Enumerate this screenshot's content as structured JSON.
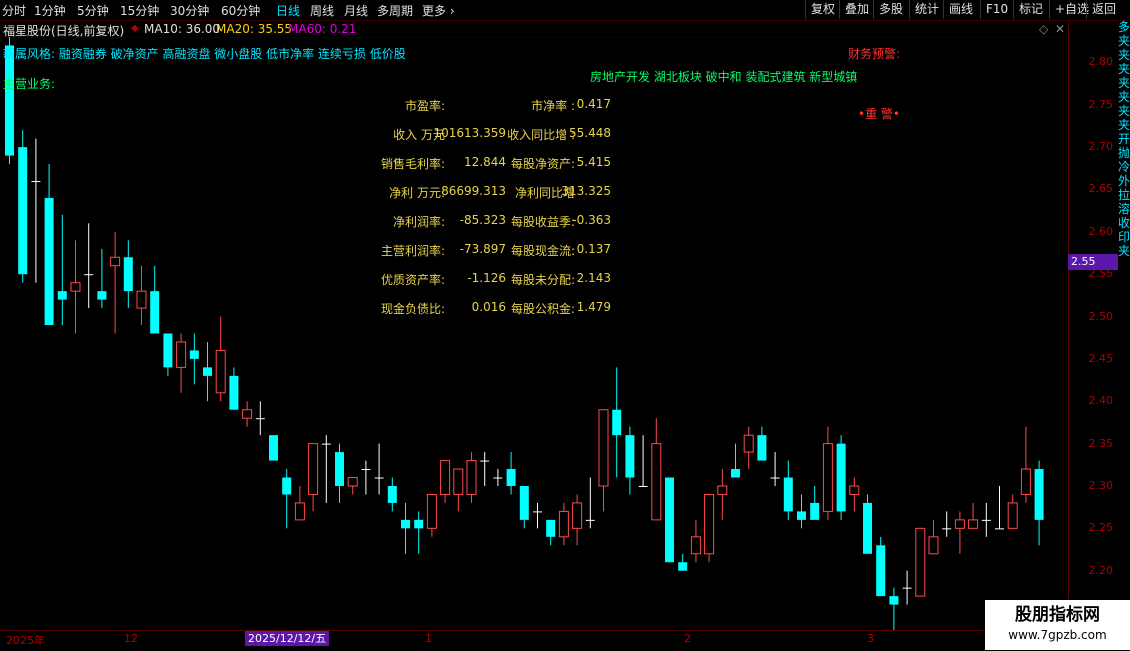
{
  "toolbar": {
    "timeframes": [
      "分时",
      "1分钟",
      "5分钟",
      "15分钟",
      "30分钟",
      "60分钟",
      "日线",
      "周线",
      "月线",
      "多周期",
      "更多"
    ],
    "active": "日线",
    "right_buttons": [
      "复权",
      "叠加",
      "多股",
      "统计",
      "画线",
      "F10",
      "标记",
      "+自选",
      "返回"
    ]
  },
  "title": {
    "stock": "福星股份(日线,前复权)",
    "ma10": "MA10: 36.00",
    "ma20": "MA20: 35.55",
    "ma60": "MA60: 0.21",
    "ma10_color": "#e0e0e0",
    "ma20_color": "#ffd200",
    "ma60_color": "#e000e0"
  },
  "tags": {
    "line1": "新属风格: 融资融券 破净资产 高融资盘 微小盘股 低市净率 连续亏损 低价股",
    "line2": "主营业务:",
    "concepts": "房地产开发 湖北板块 破中和 装配式建筑 新型城镇",
    "warning": "财务预警:",
    "heavy": "•重 警•"
  },
  "fundamentals": [
    {
      "l1": "市盈率:",
      "v1": "",
      "l2": "市净率 :",
      "v2": "0.417"
    },
    {
      "l1": "收入 万元",
      "v1": "101613.359",
      "l2": "收入同比增 :",
      "v2": "55.448"
    },
    {
      "l1": "销售毛利率:",
      "v1": "12.844",
      "l2": "每股净资产:",
      "v2": "5.415"
    },
    {
      "l1": "净利 万元:",
      "v1": "86699.313",
      "l2": "净利同比增",
      "v2": "313.325"
    },
    {
      "l1": "净利润率:",
      "v1": "-85.323",
      "l2": "每股收益季:",
      "v2": "-0.363"
    },
    {
      "l1": "主营利润率:",
      "v1": "-73.897",
      "l2": "每股现金流:",
      "v2": "0.137"
    },
    {
      "l1": "优质资产率:",
      "v1": "-1.126",
      "l2": "每股未分配:",
      "v2": "2.143"
    },
    {
      "l1": "现金负债比:",
      "v1": "0.016",
      "l2": "每股公积金:",
      "v2": "1.479"
    }
  ],
  "price_axis": {
    "ticks": [
      "2.80",
      "2.75",
      "2.70",
      "2.65",
      "2.60",
      "2.55",
      "2.50",
      "2.45",
      "2.40",
      "2.35",
      "2.30",
      "2.25",
      "2.20",
      "2.15"
    ],
    "current": "2.55"
  },
  "x_axis": {
    "labels": [
      "2025年",
      "12",
      "1",
      "2",
      "3"
    ],
    "selected": "2025/12/12/五"
  },
  "side_strip": "多夹夹夹夹夹夹夹开抛冷外拉溶收印夹",
  "watermark": {
    "name": "股朋指标网",
    "url": "www.7gpzb.com"
  },
  "chart_data": {
    "type": "candlestick",
    "up_color": "#ff4a4a",
    "down_color": "#00ffff",
    "ylim": [
      2.13,
      2.83
    ],
    "candles": [
      {
        "o": 2.82,
        "h": 2.85,
        "l": 2.68,
        "c": 2.69
      },
      {
        "o": 2.7,
        "h": 2.72,
        "l": 2.54,
        "c": 2.55
      },
      {
        "o": 2.66,
        "h": 2.71,
        "l": 2.54,
        "c": 2.66
      },
      {
        "o": 2.64,
        "h": 2.68,
        "l": 2.49,
        "c": 2.49
      },
      {
        "o": 2.53,
        "h": 2.62,
        "l": 2.49,
        "c": 2.52
      },
      {
        "o": 2.53,
        "h": 2.59,
        "l": 2.48,
        "c": 2.54
      },
      {
        "o": 2.55,
        "h": 2.61,
        "l": 2.51,
        "c": 2.55
      },
      {
        "o": 2.53,
        "h": 2.58,
        "l": 2.51,
        "c": 2.52
      },
      {
        "o": 2.56,
        "h": 2.6,
        "l": 2.48,
        "c": 2.57
      },
      {
        "o": 2.57,
        "h": 2.59,
        "l": 2.51,
        "c": 2.53
      },
      {
        "o": 2.51,
        "h": 2.56,
        "l": 2.49,
        "c": 2.53
      },
      {
        "o": 2.53,
        "h": 2.56,
        "l": 2.48,
        "c": 2.48
      },
      {
        "o": 2.48,
        "h": 2.48,
        "l": 2.43,
        "c": 2.44
      },
      {
        "o": 2.44,
        "h": 2.48,
        "l": 2.41,
        "c": 2.47
      },
      {
        "o": 2.46,
        "h": 2.48,
        "l": 2.42,
        "c": 2.45
      },
      {
        "o": 2.44,
        "h": 2.47,
        "l": 2.4,
        "c": 2.43
      },
      {
        "o": 2.41,
        "h": 2.5,
        "l": 2.4,
        "c": 2.46
      },
      {
        "o": 2.43,
        "h": 2.44,
        "l": 2.39,
        "c": 2.39
      },
      {
        "o": 2.38,
        "h": 2.4,
        "l": 2.37,
        "c": 2.39
      },
      {
        "o": 2.38,
        "h": 2.4,
        "l": 2.36,
        "c": 2.38
      },
      {
        "o": 2.36,
        "h": 2.36,
        "l": 2.33,
        "c": 2.33
      },
      {
        "o": 2.31,
        "h": 2.32,
        "l": 2.25,
        "c": 2.29
      },
      {
        "o": 2.26,
        "h": 2.3,
        "l": 2.26,
        "c": 2.28
      },
      {
        "o": 2.29,
        "h": 2.35,
        "l": 2.27,
        "c": 2.35
      },
      {
        "o": 2.35,
        "h": 2.36,
        "l": 2.28,
        "c": 2.35
      },
      {
        "o": 2.34,
        "h": 2.35,
        "l": 2.28,
        "c": 2.3
      },
      {
        "o": 2.3,
        "h": 2.31,
        "l": 2.29,
        "c": 2.31
      },
      {
        "o": 2.32,
        "h": 2.33,
        "l": 2.29,
        "c": 2.32
      },
      {
        "o": 2.31,
        "h": 2.35,
        "l": 2.29,
        "c": 2.31
      },
      {
        "o": 2.3,
        "h": 2.31,
        "l": 2.27,
        "c": 2.28
      },
      {
        "o": 2.26,
        "h": 2.28,
        "l": 2.22,
        "c": 2.25
      },
      {
        "o": 2.26,
        "h": 2.27,
        "l": 2.22,
        "c": 2.25
      },
      {
        "o": 2.25,
        "h": 2.29,
        "l": 2.24,
        "c": 2.29
      },
      {
        "o": 2.29,
        "h": 2.32,
        "l": 2.28,
        "c": 2.33
      },
      {
        "o": 2.29,
        "h": 2.32,
        "l": 2.27,
        "c": 2.32
      },
      {
        "o": 2.29,
        "h": 2.34,
        "l": 2.28,
        "c": 2.33
      },
      {
        "o": 2.33,
        "h": 2.34,
        "l": 2.3,
        "c": 2.33
      },
      {
        "o": 2.31,
        "h": 2.32,
        "l": 2.3,
        "c": 2.31
      },
      {
        "o": 2.32,
        "h": 2.34,
        "l": 2.29,
        "c": 2.3
      },
      {
        "o": 2.3,
        "h": 2.3,
        "l": 2.25,
        "c": 2.26
      },
      {
        "o": 2.27,
        "h": 2.28,
        "l": 2.25,
        "c": 2.27
      },
      {
        "o": 2.26,
        "h": 2.26,
        "l": 2.23,
        "c": 2.24
      },
      {
        "o": 2.24,
        "h": 2.28,
        "l": 2.23,
        "c": 2.27
      },
      {
        "o": 2.25,
        "h": 2.29,
        "l": 2.23,
        "c": 2.28
      },
      {
        "o": 2.26,
        "h": 2.31,
        "l": 2.25,
        "c": 2.26
      },
      {
        "o": 2.3,
        "h": 2.38,
        "l": 2.27,
        "c": 2.39
      },
      {
        "o": 2.39,
        "h": 2.44,
        "l": 2.31,
        "c": 2.36
      },
      {
        "o": 2.36,
        "h": 2.37,
        "l": 2.29,
        "c": 2.31
      },
      {
        "o": 2.3,
        "h": 2.36,
        "l": 2.3,
        "c": 2.3
      },
      {
        "o": 2.26,
        "h": 2.38,
        "l": 2.26,
        "c": 2.35
      },
      {
        "o": 2.31,
        "h": 2.31,
        "l": 2.21,
        "c": 2.21
      },
      {
        "o": 2.21,
        "h": 2.22,
        "l": 2.2,
        "c": 2.2
      },
      {
        "o": 2.22,
        "h": 2.26,
        "l": 2.21,
        "c": 2.24
      },
      {
        "o": 2.22,
        "h": 2.28,
        "l": 2.21,
        "c": 2.29
      },
      {
        "o": 2.29,
        "h": 2.32,
        "l": 2.26,
        "c": 2.3
      },
      {
        "o": 2.32,
        "h": 2.35,
        "l": 2.31,
        "c": 2.31
      },
      {
        "o": 2.34,
        "h": 2.37,
        "l": 2.32,
        "c": 2.36
      },
      {
        "o": 2.36,
        "h": 2.37,
        "l": 2.33,
        "c": 2.33
      },
      {
        "o": 2.31,
        "h": 2.34,
        "l": 2.3,
        "c": 2.31
      },
      {
        "o": 2.31,
        "h": 2.33,
        "l": 2.26,
        "c": 2.27
      },
      {
        "o": 2.27,
        "h": 2.29,
        "l": 2.25,
        "c": 2.26
      },
      {
        "o": 2.28,
        "h": 2.3,
        "l": 2.27,
        "c": 2.26
      },
      {
        "o": 2.27,
        "h": 2.37,
        "l": 2.26,
        "c": 2.35
      },
      {
        "o": 2.35,
        "h": 2.36,
        "l": 2.26,
        "c": 2.27
      },
      {
        "o": 2.29,
        "h": 2.31,
        "l": 2.27,
        "c": 2.3
      },
      {
        "o": 2.28,
        "h": 2.29,
        "l": 2.22,
        "c": 2.22
      },
      {
        "o": 2.23,
        "h": 2.24,
        "l": 2.18,
        "c": 2.17
      },
      {
        "o": 2.17,
        "h": 2.18,
        "l": 2.13,
        "c": 2.16
      },
      {
        "o": 2.18,
        "h": 2.2,
        "l": 2.16,
        "c": 2.18
      },
      {
        "o": 2.17,
        "h": 2.25,
        "l": 2.17,
        "c": 2.25
      },
      {
        "o": 2.22,
        "h": 2.26,
        "l": 2.22,
        "c": 2.24
      },
      {
        "o": 2.25,
        "h": 2.27,
        "l": 2.24,
        "c": 2.25
      },
      {
        "o": 2.25,
        "h": 2.27,
        "l": 2.22,
        "c": 2.26
      },
      {
        "o": 2.25,
        "h": 2.28,
        "l": 2.25,
        "c": 2.26
      },
      {
        "o": 2.26,
        "h": 2.28,
        "l": 2.24,
        "c": 2.26
      },
      {
        "o": 2.25,
        "h": 2.3,
        "l": 2.25,
        "c": 2.25
      },
      {
        "o": 2.25,
        "h": 2.29,
        "l": 2.25,
        "c": 2.28
      },
      {
        "o": 2.29,
        "h": 2.37,
        "l": 2.28,
        "c": 2.32
      },
      {
        "o": 2.32,
        "h": 2.33,
        "l": 2.23,
        "c": 2.26
      }
    ]
  }
}
